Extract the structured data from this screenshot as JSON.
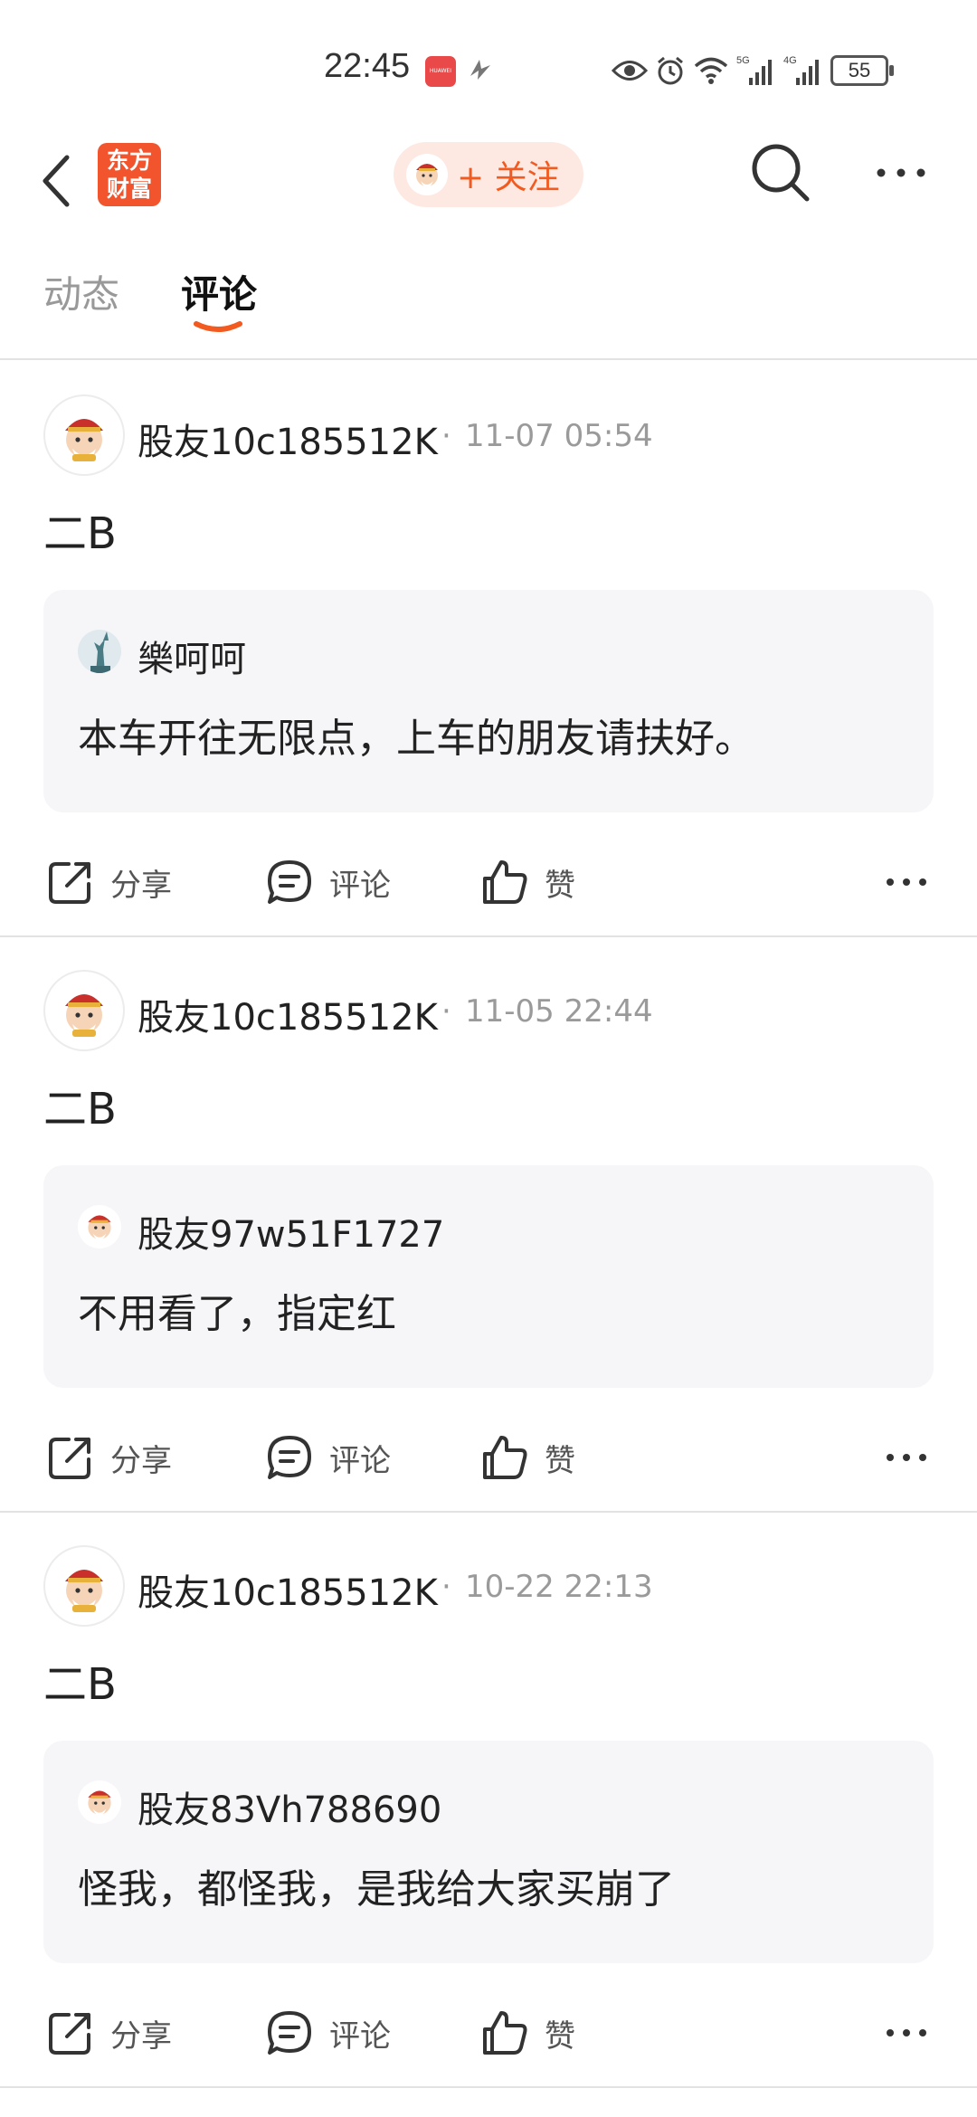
{
  "status_bar": {
    "time": "22:45",
    "battery": "55",
    "huawei_badge": "HUAWEI",
    "network_left": "5G",
    "network_right": "4G"
  },
  "header": {
    "logo_line1": "东方",
    "logo_line2": "财富",
    "follow_label": "+ 关注"
  },
  "tabs": [
    {
      "label": "动态"
    },
    {
      "label": "评论"
    }
  ],
  "accent_color": "#f25a1f",
  "posts": [
    {
      "user": "股友10c185512K",
      "time": "11-07 05:54",
      "text": "二B",
      "quote_user": "樂呵呵",
      "quote_text": "本车开往无限点，上车的朋友请扶好。",
      "quote_avatar": "statue-of-liberty-icon"
    },
    {
      "user": "股友10c185512K",
      "time": "11-05 22:44",
      "text": "二B",
      "quote_user": "股友97w51F1727",
      "quote_text": "不用看了，指定红",
      "quote_avatar": "fortune-god-icon"
    },
    {
      "user": "股友10c185512K",
      "time": "10-22 22:13",
      "text": "二B",
      "quote_user": "股友83Vh788690",
      "quote_text": "怪我，都怪我，是我给大家买崩了",
      "quote_avatar": "fortune-god-icon"
    }
  ],
  "actions": {
    "share": "分享",
    "comment": "评论",
    "like": "赞"
  }
}
